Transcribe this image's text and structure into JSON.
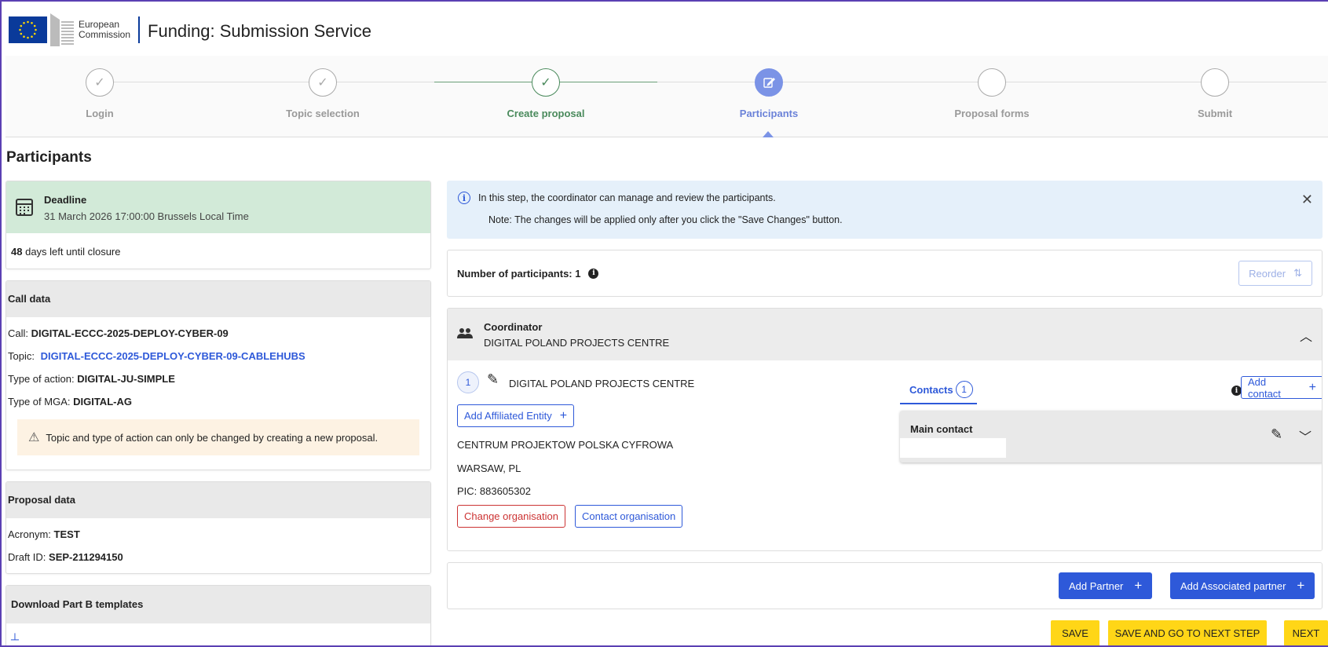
{
  "header": {
    "org_line1": "European",
    "org_line2": "Commission",
    "app_title": "Funding: Submission Service"
  },
  "stepper": {
    "steps": [
      {
        "label": "Login",
        "state": "done"
      },
      {
        "label": "Topic selection",
        "state": "done"
      },
      {
        "label": "Create proposal",
        "state": "done"
      },
      {
        "label": "Participants",
        "state": "current"
      },
      {
        "label": "Proposal forms",
        "state": "todo"
      },
      {
        "label": "Submit",
        "state": "todo"
      }
    ]
  },
  "page": {
    "title": "Participants"
  },
  "deadline": {
    "title": "Deadline",
    "date": "31 March 2026 17:00:00 Brussels Local Time",
    "days_number": "48",
    "days_text": "days left until closure"
  },
  "call_data": {
    "heading": "Call data",
    "call_label": "Call:",
    "call_value": "DIGITAL-ECCC-2025-DEPLOY-CYBER-09",
    "topic_label": "Topic:",
    "topic_value": "DIGITAL-ECCC-2025-DEPLOY-CYBER-09-CABLEHUBS",
    "action_label": "Type of action:",
    "action_value": "DIGITAL-JU-SIMPLE",
    "mga_label": "Type of MGA:",
    "mga_value": "DIGITAL-AG",
    "warning": "Topic and type of action can only be changed by creating a new proposal."
  },
  "proposal_data": {
    "heading": "Proposal data",
    "acronym_label": "Acronym:",
    "acronym_value": "TEST",
    "draft_label": "Draft ID:",
    "draft_value": "SEP-211294150"
  },
  "download": {
    "heading": "Download Part B templates"
  },
  "info_banner": {
    "line1": "In this step, the coordinator can manage and review the participants.",
    "line2": "Note: The changes will be applied only after you click the \"Save Changes\" button."
  },
  "participants_count": {
    "label": "Number of participants: 1",
    "reorder_label": "Reorder"
  },
  "coordinator": {
    "role": "Coordinator",
    "name": "DIGITAL POLAND PROJECTS CENTRE",
    "number": "1",
    "org_name": "DIGITAL POLAND PROJECTS CENTRE",
    "add_affiliated_label": "Add Affiliated Entity",
    "legal_name": "CENTRUM PROJEKTOW POLSKA CYFROWA",
    "location": "WARSAW, PL",
    "pic": "PIC: 883605302",
    "change_org_label": "Change organisation",
    "contact_org_label": "Contact organisation"
  },
  "contacts": {
    "tab_label": "Contacts",
    "count": "1",
    "add_contact_label": "Add contact",
    "main_contact_label": "Main contact"
  },
  "partner_actions": {
    "add_partner_label": "Add Partner",
    "add_associated_label": "Add Associated partner"
  },
  "footer_actions": {
    "save_label": "SAVE",
    "save_next_label": "SAVE AND GO TO NEXT STEP",
    "next_label": "NEXT"
  },
  "colors": {
    "primary": "#2e59d9",
    "success": "#4a8a5c",
    "deadline_bg": "#d2ead8",
    "warning_bg": "#fdf2e3",
    "info_bg": "#e5f0fa",
    "action_yellow": "#ffd617"
  }
}
